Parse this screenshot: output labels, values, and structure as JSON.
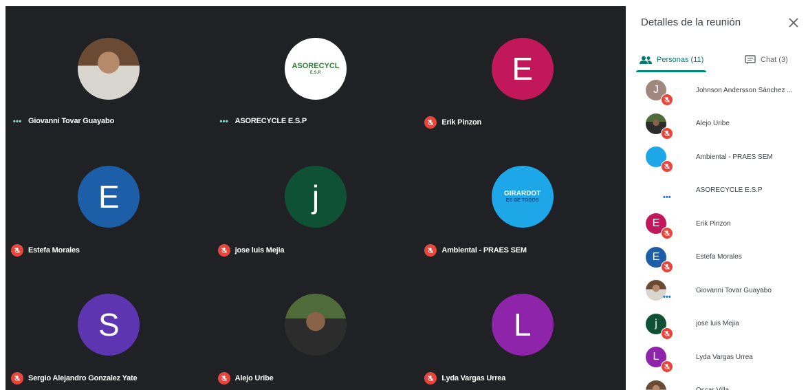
{
  "grid": {
    "tiles": [
      {
        "name": "Giovanni Tovar Guayabo",
        "status": "speaking-dots",
        "avatar": {
          "type": "photo",
          "style": "giovanni"
        }
      },
      {
        "name": "ASORECYCLE E.S.P",
        "status": "speaking-dots",
        "avatar": {
          "type": "logo",
          "style": "aso",
          "line1": "ASORECYCL",
          "line2": "E.S.P."
        }
      },
      {
        "name": "Erik Pinzon",
        "status": "muted",
        "avatar": {
          "type": "letter",
          "letter": "E",
          "color": "#c2185b"
        }
      },
      {
        "name": "Estefa Morales",
        "status": "muted",
        "avatar": {
          "type": "letter",
          "letter": "E",
          "color": "#1c5fa8"
        }
      },
      {
        "name": "jose luis Mejia",
        "status": "muted",
        "avatar": {
          "type": "letter",
          "letter": "j",
          "color": "#0f5134"
        }
      },
      {
        "name": "Ambiental - PRAES SEM",
        "status": "muted",
        "avatar": {
          "type": "logo",
          "style": "gir",
          "line1": "GIRARDOT",
          "line2": "ES DE TODOS"
        }
      },
      {
        "name": "Sergio Alejandro Gonzalez Yate",
        "status": "muted",
        "avatar": {
          "type": "letter",
          "letter": "S",
          "color": "#5e35b1"
        }
      },
      {
        "name": "Alejo Uribe",
        "status": "muted",
        "avatar": {
          "type": "photo",
          "style": "alejo"
        }
      },
      {
        "name": "Lyda Vargas Urrea",
        "status": "muted",
        "avatar": {
          "type": "letter",
          "letter": "L",
          "color": "#8e24aa"
        }
      }
    ]
  },
  "panel": {
    "title": "Detalles de la reunión",
    "tabs": {
      "people_label": "Personas (11)",
      "chat_label": "Chat (3)"
    },
    "people": [
      {
        "name": "Johnson Andersson Sánchez ...",
        "status": "muted",
        "avatar": {
          "type": "letter",
          "letter": "J",
          "color": "#a1887f"
        }
      },
      {
        "name": "Alejo Uribe",
        "status": "muted",
        "avatar": {
          "type": "photo",
          "style": "alejo"
        }
      },
      {
        "name": "Ambiental - PRAES SEM",
        "status": "muted",
        "avatar": {
          "type": "logo",
          "style": "gir"
        }
      },
      {
        "name": "ASORECYCLE E.S.P",
        "status": "speaking-dots",
        "avatar": {
          "type": "logo",
          "style": "aso"
        }
      },
      {
        "name": "Erik Pinzon",
        "status": "muted",
        "avatar": {
          "type": "letter",
          "letter": "E",
          "color": "#c2185b"
        }
      },
      {
        "name": "Estefa Morales",
        "status": "muted",
        "avatar": {
          "type": "letter",
          "letter": "E",
          "color": "#1c5fa8"
        }
      },
      {
        "name": "Giovanni Tovar Guayabo",
        "status": "speaking-dots",
        "avatar": {
          "type": "photo",
          "style": "giovanni"
        }
      },
      {
        "name": "jose luis Mejia",
        "status": "muted",
        "avatar": {
          "type": "letter",
          "letter": "j",
          "color": "#0f5134"
        }
      },
      {
        "name": "Lyda Vargas Urrea",
        "status": "muted",
        "avatar": {
          "type": "letter",
          "letter": "L",
          "color": "#8e24aa"
        }
      },
      {
        "name": "Oscar Villa",
        "status": "muted",
        "avatar": {
          "type": "photo",
          "style": "giovanni"
        }
      }
    ]
  },
  "colors": {
    "grid_bg": "#202124",
    "mic_off": "#e8453c",
    "accent": "#00897b"
  }
}
